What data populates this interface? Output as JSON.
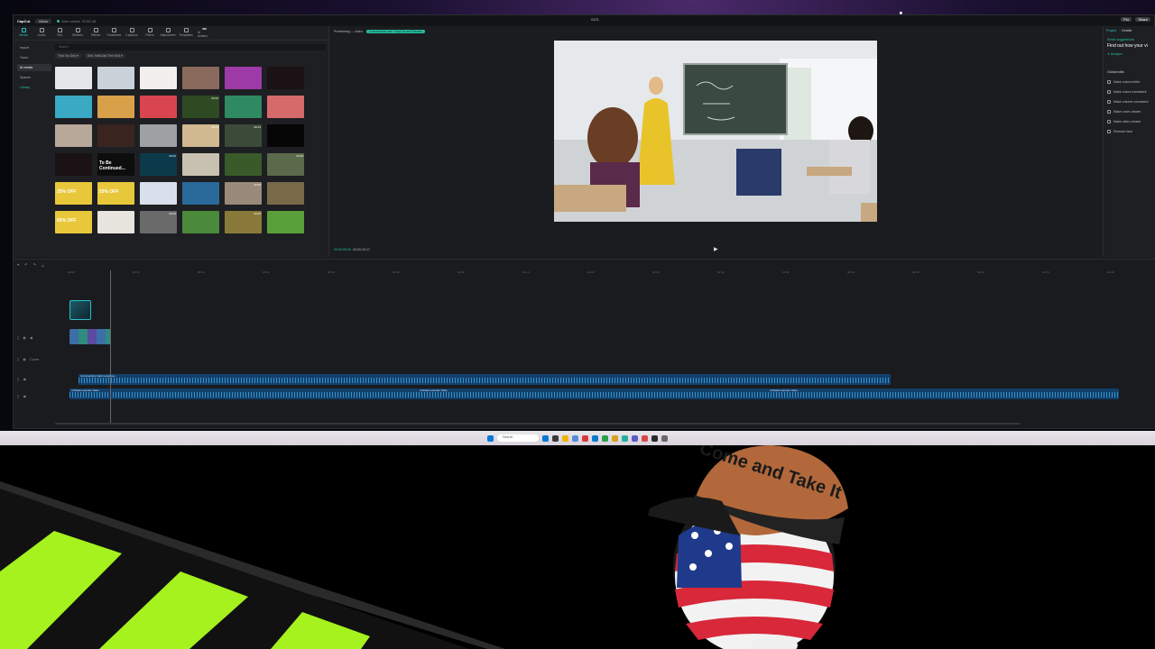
{
  "titlebar": {
    "logo": "CapCut",
    "menu": "Menu",
    "autosave": "Auto saved: 02:55:48",
    "window_title": "0321",
    "pro_badge": "Pro",
    "share_button": "Share"
  },
  "media_tabs": [
    "Media",
    "Audio",
    "Text",
    "Stickers",
    "Effects",
    "Transitions",
    "Captions",
    "Filters",
    "Adjustment",
    "Templates",
    "AI avatars"
  ],
  "media_side": [
    "Import",
    "Yours",
    "AI media",
    "Spaces",
    "Library"
  ],
  "media_search": {
    "placeholder": "Search"
  },
  "media_filters": [
    "Trial: No Grid ▾",
    "Grid: Half/Just Trim Grid ▾"
  ],
  "thumbnails": [
    {
      "bg": "#e4e6ea",
      "label": "",
      "dur": ""
    },
    {
      "bg": "#c8d2d8",
      "label": "",
      "dur": ""
    },
    {
      "bg": "#f2f0ee",
      "label": "",
      "dur": ""
    },
    {
      "bg": "#8a6a5c",
      "label": "",
      "dur": ""
    },
    {
      "bg": "#9d3aa8",
      "label": "",
      "dur": ""
    },
    {
      "bg": "#1a1214",
      "label": "",
      "dur": ""
    },
    {
      "bg": "#3aa9c4",
      "label": "",
      "dur": ""
    },
    {
      "bg": "#d9a04a",
      "label": "",
      "dur": ""
    },
    {
      "bg": "#d8454e",
      "label": "",
      "dur": ""
    },
    {
      "bg": "#2e4a22",
      "label": "",
      "dur": "00:02"
    },
    {
      "bg": "#2f8a62",
      "label": "",
      "dur": ""
    },
    {
      "bg": "#d66a6a",
      "label": "",
      "dur": ""
    },
    {
      "bg": "#b8a89a",
      "label": "",
      "dur": ""
    },
    {
      "bg": "#3a2420",
      "label": "",
      "dur": ""
    },
    {
      "bg": "#9ea1a4",
      "label": "",
      "dur": ""
    },
    {
      "bg": "#d0b890",
      "label": "",
      "dur": "00:03"
    },
    {
      "bg": "#3c4a3a",
      "label": "",
      "dur": "00:12"
    },
    {
      "bg": "#060606",
      "label": "",
      "dur": ""
    },
    {
      "bg": "#1a1214",
      "label": "",
      "dur": ""
    },
    {
      "bg": "#0d0d0d",
      "label": "To Be Continued...",
      "dur": ""
    },
    {
      "bg": "#0c3a4a",
      "label": "",
      "dur": "00:04"
    },
    {
      "bg": "#c8c0b0",
      "label": "",
      "dur": ""
    },
    {
      "bg": "#3a5a2a",
      "label": "",
      "dur": ""
    },
    {
      "bg": "#5a6a4a",
      "label": "",
      "dur": "00:05"
    },
    {
      "bg": "#e8c83a",
      "label": "25% OFF",
      "dur": ""
    },
    {
      "bg": "#e8c83a",
      "label": "55% OFF",
      "dur": ""
    },
    {
      "bg": "#d8e0ec",
      "label": "",
      "dur": ""
    },
    {
      "bg": "#2a6a9a",
      "label": "",
      "dur": ""
    },
    {
      "bg": "#9a8a7a",
      "label": "",
      "dur": "00:05"
    },
    {
      "bg": "#7a6a4a",
      "label": "",
      "dur": ""
    },
    {
      "bg": "#e8c83a",
      "label": "65% OFF",
      "dur": ""
    },
    {
      "bg": "#e8e4de",
      "label": "",
      "dur": ""
    },
    {
      "bg": "#6a6a6a",
      "label": "",
      "dur": "00:04"
    },
    {
      "bg": "#4a8a3a",
      "label": "",
      "dur": ""
    },
    {
      "bg": "#8a7a3a",
      "label": "",
      "dur": "00:05"
    },
    {
      "bg": "#5aa03a",
      "label": "",
      "dur": ""
    }
  ],
  "player": {
    "header": "Previewing — video",
    "header_pill": "Commercial use: CapCut and Pexels",
    "timecode": "00:00:00:00",
    "duration": "00:00:15:17"
  },
  "inspector": {
    "tab_project": "Project",
    "tab_details": "Details",
    "section": "Smart suggestions",
    "headline": "Find out how your vi",
    "analyze": "✦ Analyze",
    "global_edits": "Global edits",
    "items": [
      "Make colors better",
      "Make colors consistent",
      "Make volume consistent",
      "Make voice clearer",
      "Make video clearer",
      "Retouch face"
    ]
  },
  "timeline": {
    "ruler_ticks": [
      "00:00",
      "00:10",
      "00:20",
      "00:30",
      "00:40",
      "00:50",
      "01:00",
      "01:10",
      "01:20",
      "01:30",
      "01:40",
      "01:50",
      "02:00",
      "02:10",
      "02:20",
      "02:30",
      "02:40"
    ],
    "cover_label": "Cover",
    "audio1_label": "Commentary track templates",
    "audio2_labels": [
      "AnDaebi episode Taste",
      "AnDaebi episode Taste",
      "AnDaebi episode Taste"
    ]
  },
  "taskbar": {
    "search_placeholder": "Search",
    "icons": [
      "#0078d4",
      "#3a3a3a",
      "#f0b400",
      "#5a8ad8",
      "#d83a3a",
      "#0a7ad0",
      "#2aa04a",
      "#d8a020",
      "#24b0a0",
      "#5a5ac8",
      "#d84a4a",
      "#2a2a2a",
      "#6a6a6a"
    ]
  },
  "scene": {
    "cap_text": "Come and Take It",
    "stripe_color": "#a6f21f"
  }
}
